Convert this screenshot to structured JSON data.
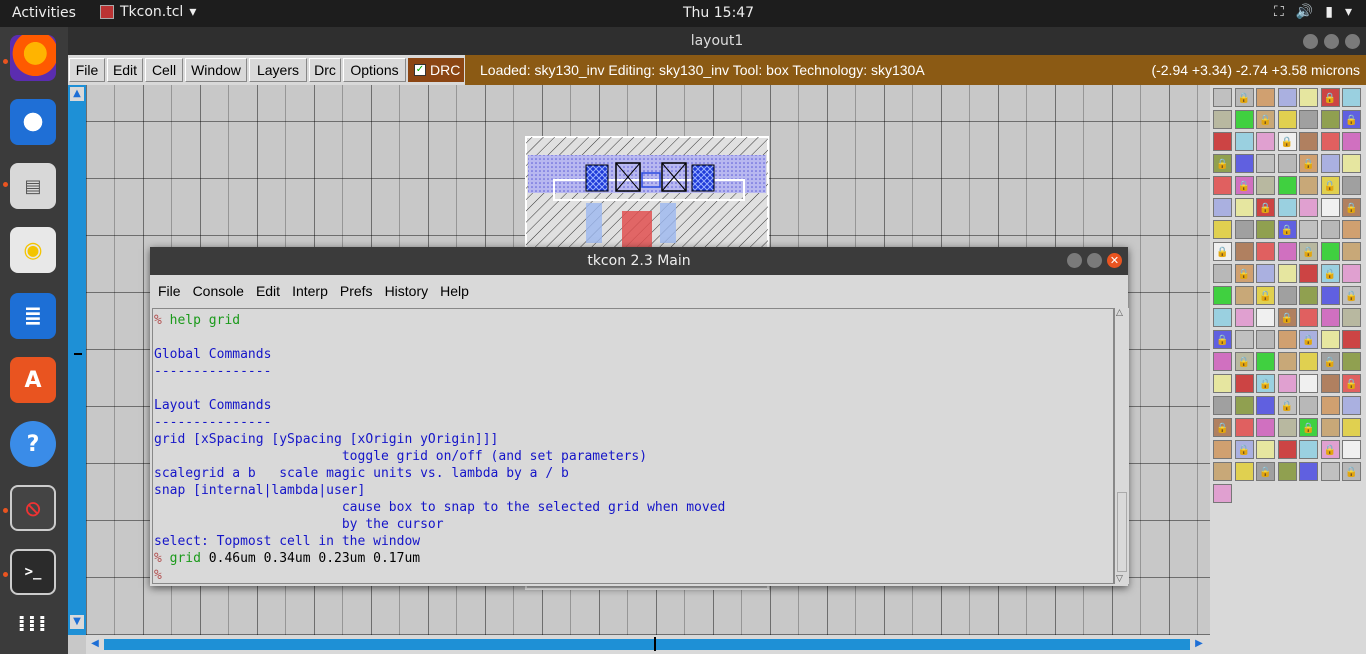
{
  "topbar": {
    "activities": "Activities",
    "app_name": "Tkcon.tcl",
    "clock": "Thu 15:47",
    "tray_icons": [
      "network-icon",
      "volume-icon",
      "battery-icon",
      "power-menu-icon"
    ]
  },
  "dock": {
    "apps": [
      "firefox-icon",
      "thunderbird-icon",
      "files-icon",
      "rhythmbox-icon",
      "writer-icon",
      "software-icon",
      "help-icon",
      "no-entry-icon",
      "terminal-icon",
      "show-apps-icon"
    ]
  },
  "magic": {
    "window_title": "layout1",
    "menu": [
      "File",
      "Edit",
      "Cell",
      "Window",
      "Layers",
      "Drc",
      "Options"
    ],
    "drc_label": "DRC",
    "status_loaded": "Loaded: sky130_inv Editing: sky130_inv Tool: box  Technology: sky130A",
    "status_coords": "(-2.94 +3.34) -2.74 +3.58 microns"
  },
  "tkcon": {
    "title": "tkcon 2.3 Main",
    "menu": [
      "File",
      "Console",
      "Edit",
      "Interp",
      "Prefs",
      "History",
      "Help"
    ],
    "lines": [
      {
        "prompt": "% ",
        "text": "help grid",
        "style": "green"
      },
      {
        "prompt": "",
        "text": "",
        "style": "blue"
      },
      {
        "prompt": "",
        "text": "Global Commands",
        "style": "blue"
      },
      {
        "prompt": "",
        "text": "---------------",
        "style": "blue"
      },
      {
        "prompt": "",
        "text": "",
        "style": "blue"
      },
      {
        "prompt": "",
        "text": "Layout Commands",
        "style": "blue"
      },
      {
        "prompt": "",
        "text": "---------------",
        "style": "blue"
      },
      {
        "prompt": "",
        "text": "grid [xSpacing [ySpacing [xOrigin yOrigin]]]",
        "style": "blue"
      },
      {
        "prompt": "",
        "text": "                        toggle grid on/off (and set parameters)",
        "style": "blue"
      },
      {
        "prompt": "",
        "text": "scalegrid a b   scale magic units vs. lambda by a / b",
        "style": "blue"
      },
      {
        "prompt": "",
        "text": "snap [internal|lambda|user]",
        "style": "blue"
      },
      {
        "prompt": "",
        "text": "                        cause box to snap to the selected grid when moved",
        "style": "blue"
      },
      {
        "prompt": "",
        "text": "                        by the cursor",
        "style": "blue"
      },
      {
        "prompt": "",
        "text": "select: Topmost cell in the window",
        "style": "blue"
      },
      {
        "prompt": "% ",
        "text": "grid",
        "style": "green",
        "rest": " 0.46um 0.34um 0.23um 0.17um"
      },
      {
        "prompt": "%",
        "text": "",
        "style": "green"
      }
    ]
  },
  "colors": {
    "scroll_blue": "#1e90d6",
    "status_brown": "#8b5a14",
    "drc_brown": "#8b4513",
    "console_blue": "#1515c8",
    "console_green": "#1a9a1a",
    "ubuntu_orange": "#e95420"
  }
}
